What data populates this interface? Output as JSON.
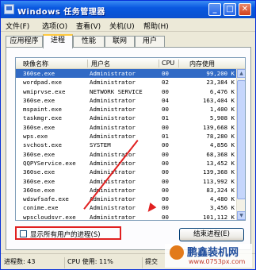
{
  "window": {
    "title": "Windows 任务管理器",
    "min": "_",
    "max": "□",
    "close": "✕",
    "icon": "task-manager-icon"
  },
  "menu": [
    "文件(F)",
    "选项(O)",
    "查看(V)",
    "关机(U)",
    "帮助(H)"
  ],
  "tabs": [
    {
      "label": "应用程序"
    },
    {
      "label": "进程",
      "active": true
    },
    {
      "label": "性能"
    },
    {
      "label": "联网"
    },
    {
      "label": "用户"
    }
  ],
  "columns": {
    "name": "映像名称",
    "user": "用户名",
    "cpu": "CPU",
    "mem": "内存使用"
  },
  "processes": [
    {
      "name": "360se.exe",
      "user": "Administrator",
      "cpu": "00",
      "mem": "99,200 K",
      "selected": true
    },
    {
      "name": "wordpad.exe",
      "user": "Administrator",
      "cpu": "02",
      "mem": "23,384 K"
    },
    {
      "name": "wmiprvse.exe",
      "user": "NETWORK SERVICE",
      "cpu": "00",
      "mem": "6,476 K"
    },
    {
      "name": "360se.exe",
      "user": "Administrator",
      "cpu": "04",
      "mem": "163,404 K"
    },
    {
      "name": "mspaint.exe",
      "user": "Administrator",
      "cpu": "00",
      "mem": "1,400 K"
    },
    {
      "name": "taskmgr.exe",
      "user": "Administrator",
      "cpu": "01",
      "mem": "5,908 K"
    },
    {
      "name": "360se.exe",
      "user": "Administrator",
      "cpu": "00",
      "mem": "139,668 K"
    },
    {
      "name": "wps.exe",
      "user": "Administrator",
      "cpu": "01",
      "mem": "78,280 K"
    },
    {
      "name": "svchost.exe",
      "user": "SYSTEM",
      "cpu": "00",
      "mem": "4,856 K"
    },
    {
      "name": "360se.exe",
      "user": "Administrator",
      "cpu": "00",
      "mem": "68,368 K"
    },
    {
      "name": "QQPYService.exe",
      "user": "Administrator",
      "cpu": "00",
      "mem": "13,452 K"
    },
    {
      "name": "360se.exe",
      "user": "Administrator",
      "cpu": "00",
      "mem": "139,368 K"
    },
    {
      "name": "360se.exe",
      "user": "Administrator",
      "cpu": "00",
      "mem": "113,992 K"
    },
    {
      "name": "360se.exe",
      "user": "Administrator",
      "cpu": "00",
      "mem": "83,324 K"
    },
    {
      "name": "wdswfsafe.exe",
      "user": "Administrator",
      "cpu": "00",
      "mem": "4,480 K"
    },
    {
      "name": "conime.exe",
      "user": "Administrator",
      "cpu": "00",
      "mem": "3,456 K"
    },
    {
      "name": "wpscloudsvr.exe",
      "user": "Administrator",
      "cpu": "00",
      "mem": "101,112 K"
    },
    {
      "name": "QQ.exe",
      "user": "Administrator",
      "cpu": "00",
      "mem": "80,148 K"
    }
  ],
  "show_all_label": "显示所有用户的进程(S)",
  "end_process_label": "结束进程(E)",
  "status": {
    "processes": "进程数: 43",
    "cpu": "CPU 使用: 11%",
    "commit": "提交"
  },
  "watermark": {
    "name": "鹏鑫装机网",
    "url": "www.0753px.com"
  },
  "colors": {
    "selection": "#316ac5",
    "highlight": "#e02020",
    "title": "#0a58e0"
  }
}
